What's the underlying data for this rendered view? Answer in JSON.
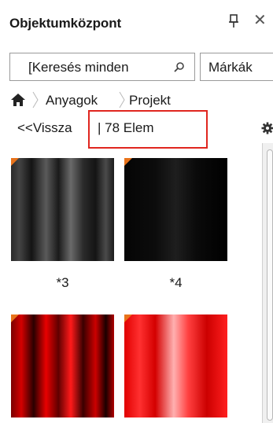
{
  "panel": {
    "title": "Objektumközpont"
  },
  "search": {
    "value": "[Keresés minden",
    "brands_label": "Márkák"
  },
  "breadcrumb": {
    "items": [
      "Anyagok",
      "Projekt"
    ]
  },
  "nav": {
    "back_label": "<<Vissza",
    "count_label": "| 78 Elem"
  },
  "tiles": [
    {
      "label": "*3"
    },
    {
      "label": "*4"
    },
    {
      "label": ""
    },
    {
      "label": ""
    }
  ],
  "colors": {
    "highlight": "#e0261f",
    "tile_corner": "#e8731b"
  }
}
